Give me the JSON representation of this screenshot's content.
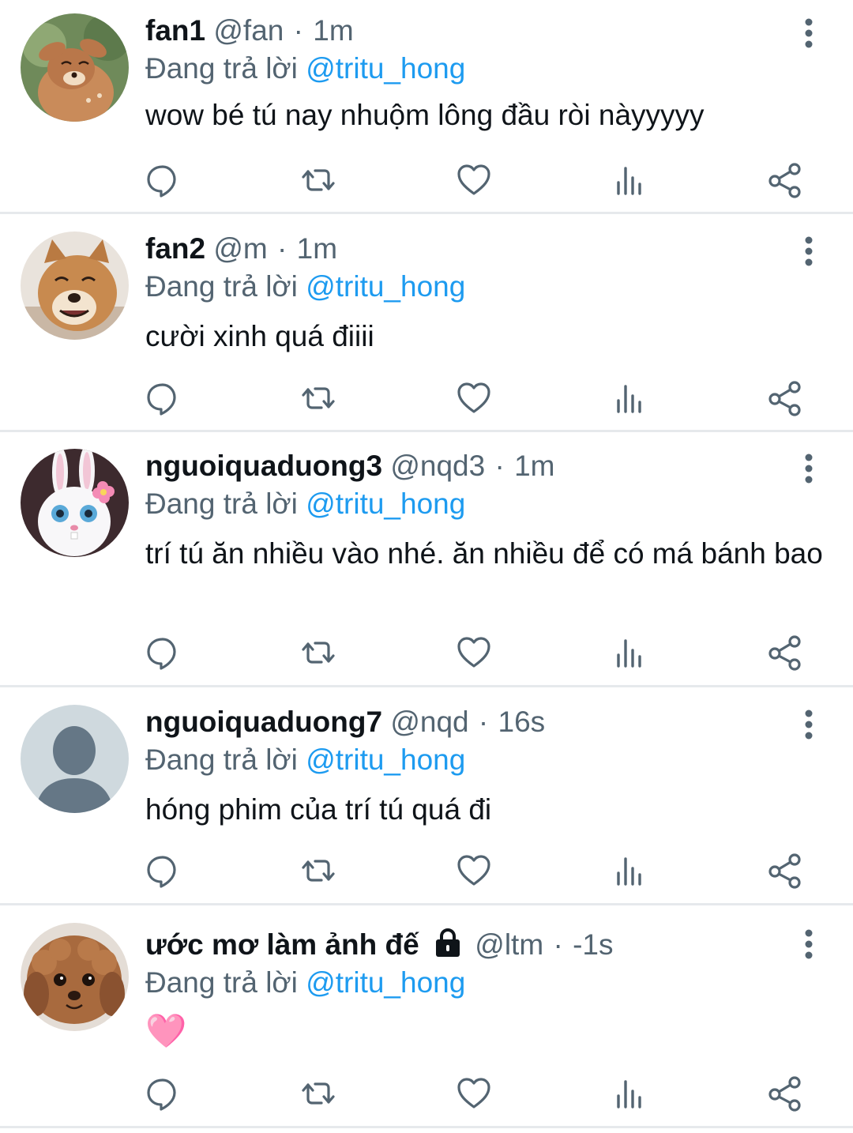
{
  "feed": {
    "tweets": [
      {
        "display_name": "fan1",
        "handle": "@fan",
        "separator": "·",
        "time": "1m",
        "replying_prefix": "Đang trả lời",
        "replying_mention": "@tritu_hong",
        "text": "wow bé tú nay nhuộm lông đầu ròi nàyyyyy",
        "avatar": "fawn-cartoon-avatar"
      },
      {
        "display_name": "fan2",
        "handle": "@m",
        "separator": "·",
        "time": "1m",
        "replying_prefix": "Đang trả lời",
        "replying_mention": "@tritu_hong",
        "text": "cười xinh quá điiii",
        "avatar": "smiling-dog-avatar"
      },
      {
        "display_name": "nguoiquaduong3",
        "handle": "@nqd3",
        "separator": "·",
        "time": "1m",
        "replying_prefix": "Đang trả lời",
        "replying_mention": "@tritu_hong",
        "text": "trí tú ăn nhiều vào nhé. ăn nhiều để có má bánh bao",
        "avatar": "white-bunny-avatar"
      },
      {
        "display_name": "nguoiquaduong7",
        "handle": "@nqd",
        "separator": "·",
        "time": "16s",
        "replying_prefix": "Đang trả lời",
        "replying_mention": "@tritu_hong",
        "text": "hóng phim của trí tú quá đi",
        "avatar": "default-user-avatar"
      },
      {
        "display_name": "ước mơ làm ảnh đế",
        "handle": "@ltm",
        "separator": "·",
        "time": "-1s",
        "replying_prefix": "Đang trả lời",
        "replying_mention": "@tritu_hong",
        "text": "🩷",
        "avatar": "poodle-puppy-avatar",
        "protected": true
      }
    ]
  },
  "icons": {
    "reply": "reply-icon",
    "retweet": "retweet-icon",
    "like": "heart-icon",
    "views": "views-icon",
    "share": "share-icon",
    "more": "more-vertical-icon",
    "lock": "lock-icon"
  },
  "colors": {
    "text_primary": "#0f1419",
    "text_secondary": "#536471",
    "mention": "#1d9bf0",
    "divider": "#e6e9ec"
  }
}
